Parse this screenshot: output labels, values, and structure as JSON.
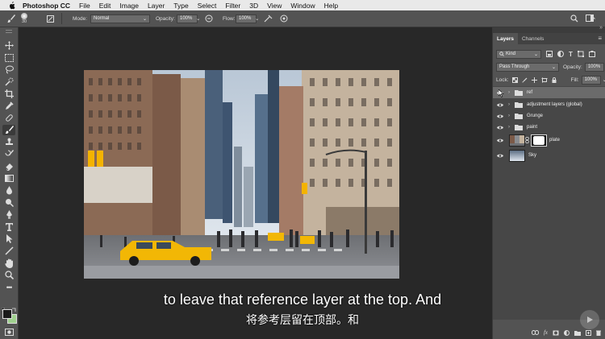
{
  "menubar": {
    "app_name": "Photoshop CC",
    "items": [
      "File",
      "Edit",
      "Image",
      "Layer",
      "Type",
      "Select",
      "Filter",
      "3D",
      "View",
      "Window",
      "Help"
    ]
  },
  "options_bar": {
    "brush_size": "30",
    "mode_label": "Mode:",
    "mode_value": "Normal",
    "opacity_label": "Opacity:",
    "opacity_value": "100%",
    "flow_label": "Flow:",
    "flow_value": "100%"
  },
  "layers_panel": {
    "tabs": [
      "Layers",
      "Channels"
    ],
    "filter_label": "Kind",
    "blend_mode": "Pass Through",
    "opacity_label": "Opacity:",
    "opacity_value": "100%",
    "lock_label": "Lock:",
    "fill_label": "Fill:",
    "fill_value": "100%",
    "layers": [
      {
        "name": "ref",
        "type": "group",
        "selected": true
      },
      {
        "name": "adjustment layers (global)",
        "type": "group"
      },
      {
        "name": "Grunge",
        "type": "group"
      },
      {
        "name": "paint",
        "type": "group"
      },
      {
        "name": "plate",
        "type": "image-with-mask"
      },
      {
        "name": "Sky",
        "type": "image"
      }
    ]
  },
  "subtitles": {
    "english": "to leave that reference layer at the top. And",
    "chinese": "将参考层留在顶部。和"
  },
  "colors": {
    "foreground": "#1a1a1a",
    "background": "#9fd08e"
  }
}
